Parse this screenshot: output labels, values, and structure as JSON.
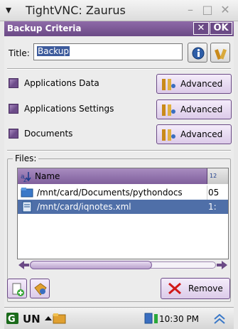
{
  "window": {
    "title": "TightVNC: Zaurus",
    "min_glyph": "–",
    "max_glyph": "□",
    "close_glyph": "✕",
    "menu_glyph": "▾"
  },
  "dialog": {
    "title": "Backup Criteria",
    "close_label": "✕",
    "ok_label": "OK"
  },
  "title_field": {
    "label": "Title:",
    "value": "Backup"
  },
  "options": [
    {
      "label": "Applications Data",
      "checked": true,
      "button": "Advanced"
    },
    {
      "label": "Applications Settings",
      "checked": true,
      "button": "Advanced"
    },
    {
      "label": "Documents",
      "checked": true,
      "button": "Advanced"
    }
  ],
  "files": {
    "legend": "Files:",
    "column_name": "Name",
    "rows": [
      {
        "path": "/mnt/card/Documents/pythondocs",
        "col2": "05",
        "selected": false
      },
      {
        "path": "/mnt/card/iqnotes.xml",
        "col2": "1:",
        "selected": true
      }
    ]
  },
  "remove_label": "Remove",
  "taskbar": {
    "clock": "10:30 PM"
  },
  "colors": {
    "accent": "#6b4a86",
    "selection": "#4f6fa8"
  }
}
